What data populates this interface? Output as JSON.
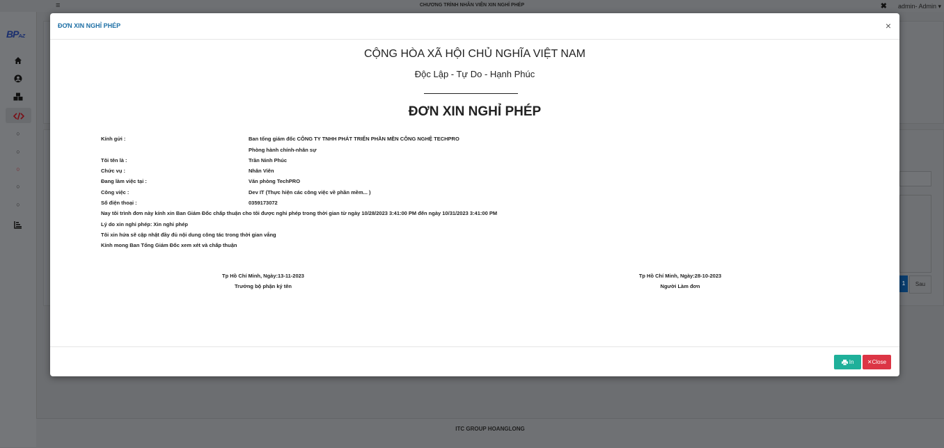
{
  "topbar": {
    "title": "CHƯƠNG TRÌNH NHÂN VIÊN XIN NGHỈ PHÉP",
    "admin": "admin- Admin ▾"
  },
  "sidebar": {
    "logo": "BP",
    "logo_sub": "A-Z"
  },
  "footer": {
    "text": "ITC GROUP HOANGLONG"
  },
  "pager": {
    "current": "1",
    "next": "Sau"
  },
  "modal": {
    "title": "ĐƠN XIN NGHỈ PHÉP",
    "close_symbol": "×",
    "nation": "CỘNG HÒA XÃ HỘI CHỦ NGHĨA VIỆT NAM",
    "motto": "Độc Lập - Tự Do - Hạnh Phúc",
    "doc_title": "ĐƠN XIN NGHỈ PHÉP",
    "fields": {
      "recipient_label": "Kính gửi :",
      "recipient_1": "Ban tổng giám đốc CÔNG TY TNHH PHÁT TRIỂN PHẦN MỀN CÔNG NGHỆ TECHPRO",
      "recipient_2": "Phòng hành chính-nhân sự",
      "name_label": "Tôi tên là :",
      "name_value": "Trần Ninh Phúc",
      "position_label": "Chức vụ :",
      "position_value": "Nhân Viên",
      "workplace_label": "Đang làm việc tại :",
      "workplace_value": "Văn phòng TechPRO",
      "job_label": "Công việc :",
      "job_value": "Dev IT (Thực hiện các công việc về phần mềm... )",
      "phone_label": "Số điện thoại :",
      "phone_value": "0359173072"
    },
    "body": {
      "line1": "Nay tôi trình đơn này kính xin Ban Giám Đốc chấp thuận cho tôi được nghỉ phép trong thời gian từ ngày 10/28/2023 3:41:00 PM đến ngày 10/31/2023 3:41:00 PM",
      "line2": "Lý do xin nghỉ phép: Xin nghỉ phép",
      "line3": "Tôi xin hứa sẽ cập nhật đầy đủ nội dung công tác trong thời gian vắng",
      "line4": "Kính mong Ban Tổng Giám Đốc xem xét và chấp thuận"
    },
    "signatures": {
      "left_date": "Tp Hồ Chí Minh, Ngày:13-11-2023",
      "left_role": "Trưởng bộ phận ký tên",
      "right_date": "Tp Hồ Chí Minh, Ngày:28-10-2023",
      "right_role": "Người Làm đơn"
    },
    "buttons": {
      "print_label": "In",
      "close_label": "Close"
    }
  }
}
